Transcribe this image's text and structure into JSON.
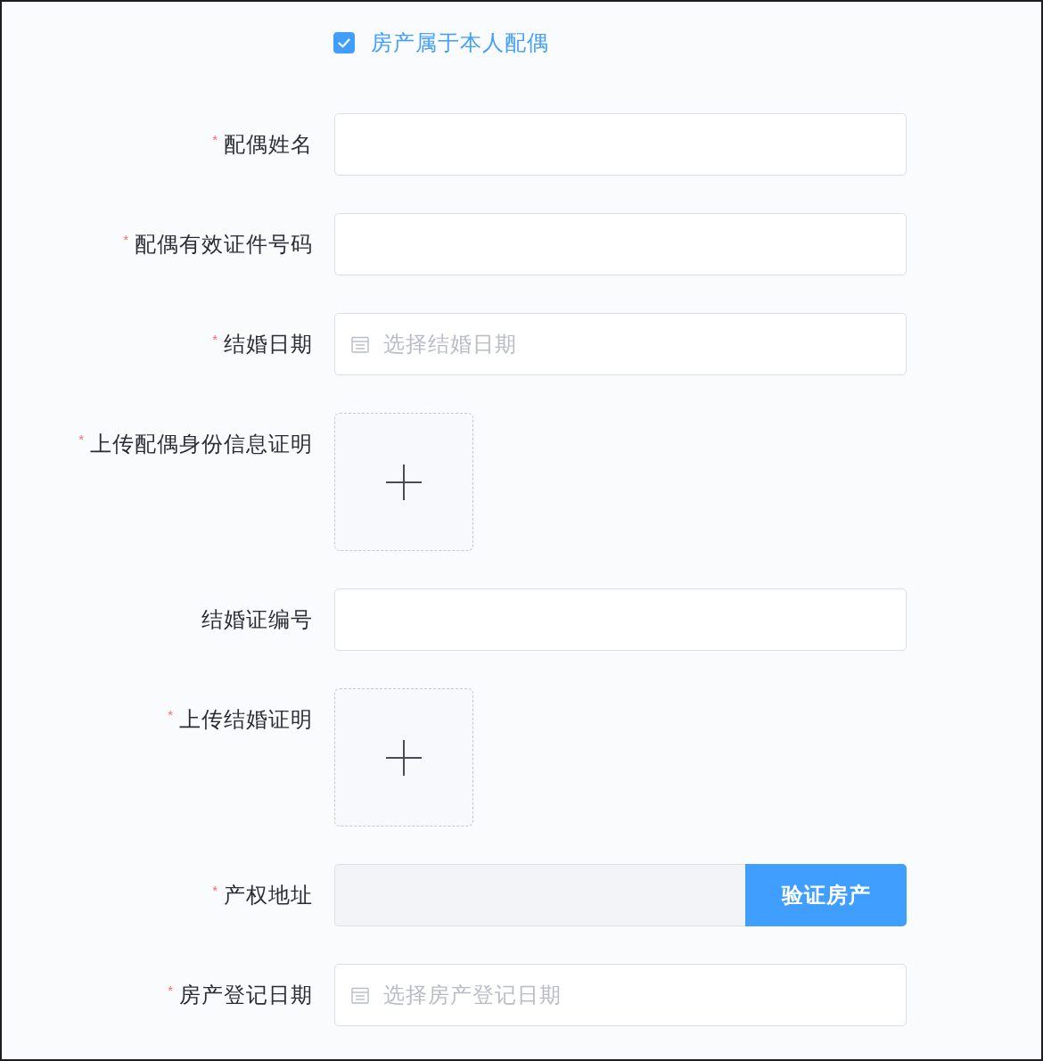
{
  "checkbox": {
    "label": "房产属于本人配偶",
    "checked": true
  },
  "required_mark": "*",
  "fields": [
    {
      "kind": "text",
      "label": "配偶姓名",
      "required": true
    },
    {
      "kind": "text",
      "label": "配偶有效证件号码",
      "required": true
    },
    {
      "kind": "date",
      "label": "结婚日期",
      "required": true,
      "placeholder": "选择结婚日期"
    },
    {
      "kind": "upload",
      "label": "上传配偶身份信息证明",
      "required": true
    },
    {
      "kind": "text",
      "label": "结婚证编号",
      "required": false
    },
    {
      "kind": "upload",
      "label": "上传结婚证明",
      "required": true
    },
    {
      "kind": "address",
      "label": "产权地址",
      "required": true,
      "disabled": true,
      "button": "验证房产"
    },
    {
      "kind": "date",
      "label": "房产登记日期",
      "required": true,
      "placeholder": "选择房产登记日期"
    }
  ]
}
